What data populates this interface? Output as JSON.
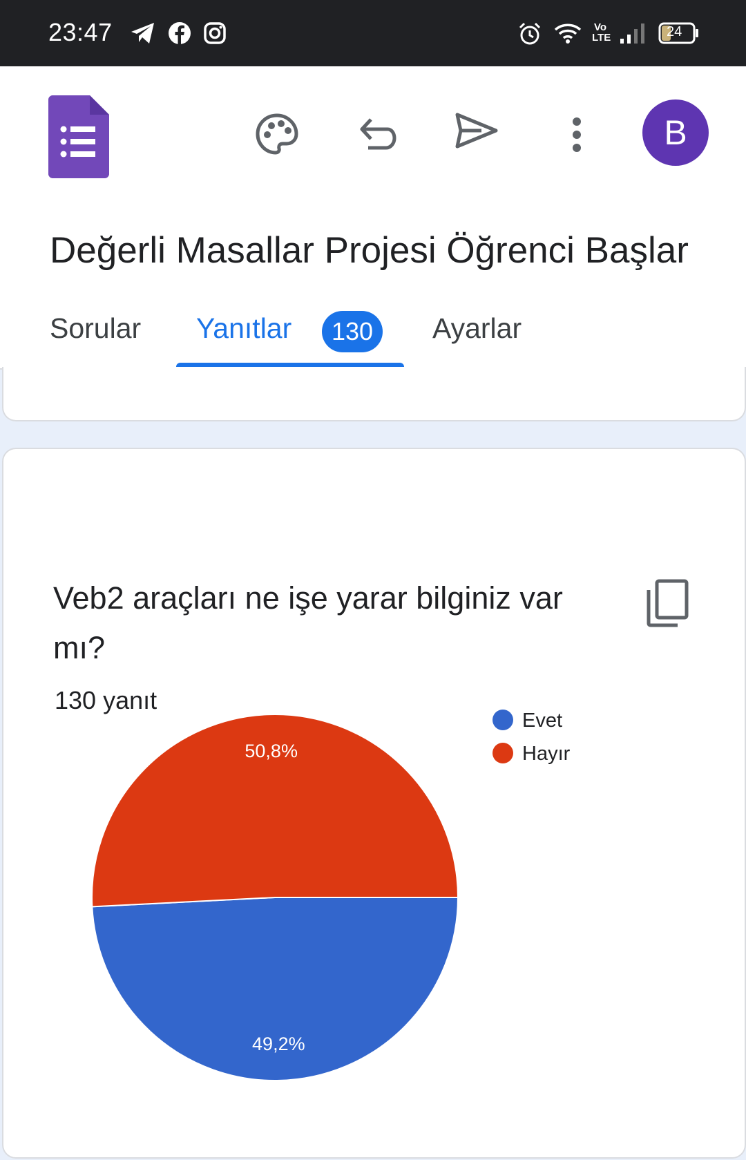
{
  "status_bar": {
    "time": "23:47",
    "left_icons": [
      "telegram-icon",
      "facebook-icon",
      "instagram-icon"
    ],
    "right_icons": [
      "alarm-icon",
      "wifi-icon",
      "volte-icon",
      "signal-icon",
      "battery-icon"
    ],
    "volte_label": "Vo LTE",
    "battery": "24"
  },
  "toolbar": {
    "app_icon": "google-forms-icon",
    "actions": [
      "palette-icon",
      "undo-icon",
      "send-icon",
      "more-vert-icon"
    ],
    "avatar_letter": "B",
    "avatar_color": "#5e35b1"
  },
  "form": {
    "title": "Değerli Masallar Projesi Öğrenci Başlar"
  },
  "tabs": {
    "questions": "Sorular",
    "responses": "Yanıtlar",
    "responses_count": "130",
    "settings": "Ayarlar",
    "active": "Yanıtlar"
  },
  "card": {
    "question": "Veb2 araçları ne işe yarar bilginiz var mı?",
    "response_count": "130 yanıt",
    "copy_icon": "copy-icon"
  },
  "colors": {
    "accent": "#1a73e8",
    "background": "#e8effa",
    "evet": "#3366cc",
    "hayir": "#dc3912"
  },
  "chart_data": {
    "type": "pie",
    "categories": [
      "Evet",
      "Hayır"
    ],
    "values": [
      49.2,
      50.8
    ],
    "labels": [
      "49,2%",
      "50,8%"
    ],
    "colors": [
      "#3366cc",
      "#dc3912"
    ],
    "legend": "top-right"
  }
}
